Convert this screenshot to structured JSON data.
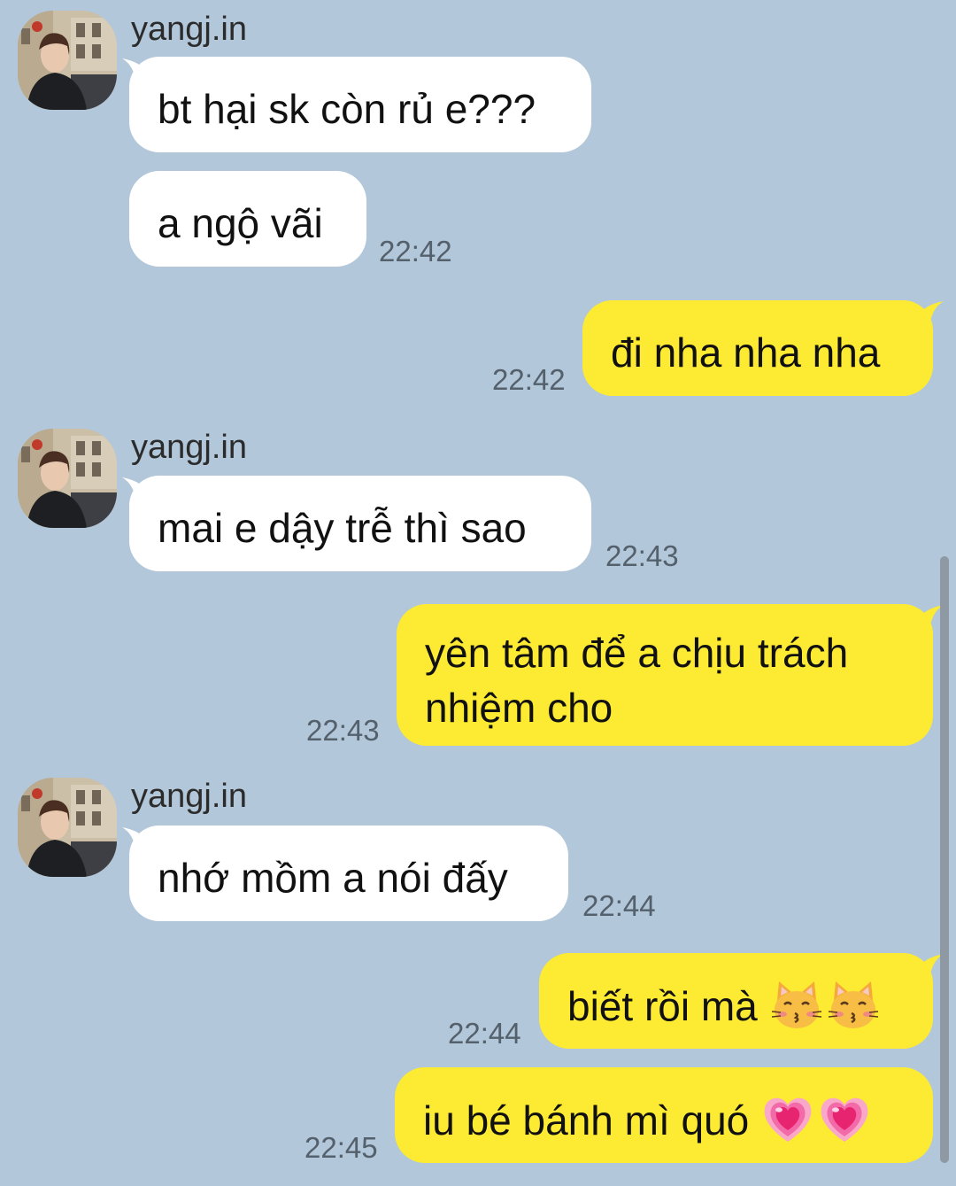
{
  "contact": {
    "name": "yangj.in"
  },
  "colors": {
    "background": "#b2c7d9",
    "incoming": "#ffffff",
    "outgoing": "#fdea33"
  },
  "messages": [
    {
      "from": "them",
      "text": "bt hại sk còn rủ e???"
    },
    {
      "from": "them",
      "text": "a ngộ vãi",
      "time": "22:42"
    },
    {
      "from": "me",
      "text": "đi nha nha nha",
      "time": "22:42"
    },
    {
      "from": "them",
      "text": "mai e dậy trễ thì sao",
      "time": "22:43"
    },
    {
      "from": "me",
      "text": "yên tâm để a chịu trách nhiệm cho",
      "time": "22:43"
    },
    {
      "from": "them",
      "text": "nhớ mồm a nói đấy",
      "time": "22:44"
    },
    {
      "from": "me",
      "text": "biết rồi mà",
      "emoji": [
        "kissing-cat-icon",
        "kissing-cat-icon"
      ],
      "time": "22:44"
    },
    {
      "from": "me",
      "text": "iu bé bánh mì quó",
      "emoji": [
        "growing-heart-icon",
        "growing-heart-icon"
      ],
      "time": "22:45"
    }
  ]
}
